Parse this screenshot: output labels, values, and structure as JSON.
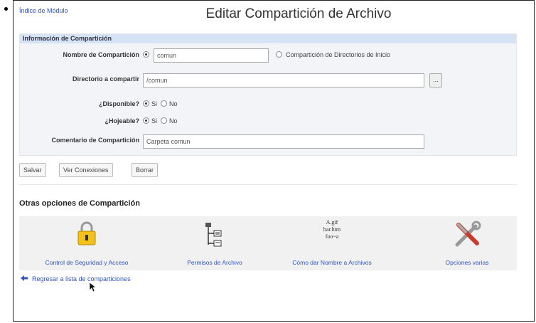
{
  "header": {
    "module_link": "Índice de Módulo",
    "title": "Editar Compartición de Archivo"
  },
  "form": {
    "section_title": "Información de Compartición",
    "share_name_label": "Nombre de Compartición",
    "share_name_value": "comun",
    "home_dirs_option": "Compartición de Directorios de Inicio",
    "dir_label": "Directorio a compartir",
    "dir_value": "/comun",
    "browse_label": "...",
    "available_label": "¿Disponible?",
    "browsable_label": "¿Hojeable?",
    "yes_label": "Si",
    "no_label": "No",
    "comment_label": "Comentario de Compartición",
    "comment_value": "Carpeta comun"
  },
  "buttons": {
    "save": "Salvar",
    "view_connections": "Ver Conexiones",
    "delete": "Borrar"
  },
  "other_options": {
    "title": "Otras opciones de Compartición",
    "items": [
      {
        "label": "Control de Seguridad y Acceso",
        "icon": "padlock-icon"
      },
      {
        "label": "Permisos de Archivo",
        "icon": "file-tree-icon"
      },
      {
        "label": "Cómo dar Nombre a Archivos",
        "icon": "file-naming-icon"
      },
      {
        "label": "Opciones varias",
        "icon": "tools-icon"
      }
    ],
    "naming_icon_lines": [
      "A.gif",
      "bar.htm",
      "foo~a"
    ]
  },
  "footer": {
    "back_link": "Regresar a lista de comparticiones"
  },
  "colors": {
    "link": "#3355bb",
    "header_band": "#d5e3f5"
  }
}
